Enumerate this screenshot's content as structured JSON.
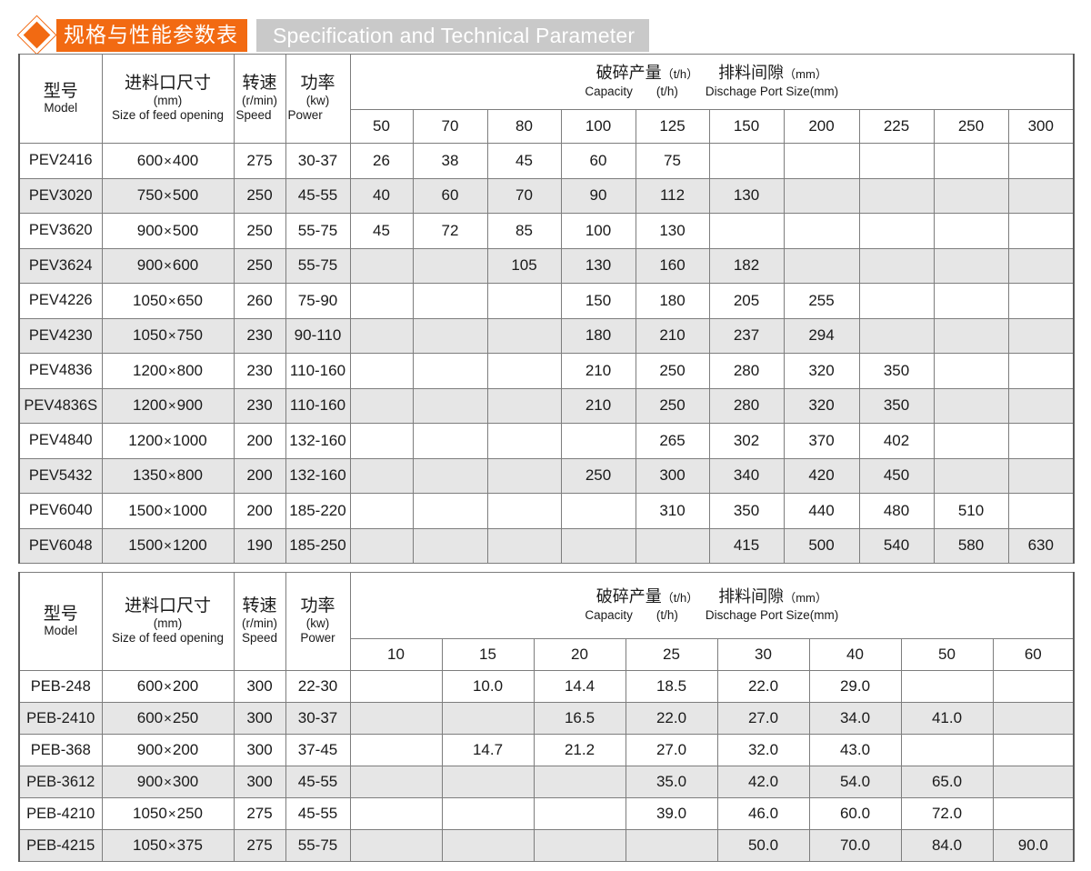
{
  "banner": {
    "diamond_icon": "diamond-icon",
    "title_cn": "规格与性能参数表",
    "title_en": "Specification and Technical Parameter"
  },
  "tables": [
    {
      "id": "pev-table",
      "headers": {
        "model_cn": "型号",
        "model_en": "Model",
        "feed_cn": "进料口尺寸",
        "feed_unit": "(mm)",
        "feed_en": "Size of feed opening",
        "speed_cn": "转速",
        "speed_unit": "(r/min)",
        "speed_en": "Speed",
        "power_cn": "功率",
        "power_unit": "(kw)",
        "power_en": "Power",
        "group_cn_1": "破碎产量",
        "group_cn_1_unit": "（t/h）",
        "group_cn_2": "排料间隙",
        "group_cn_2_unit": "（mm）",
        "group_en_1": "Capacity",
        "group_en_1_unit": "(t/h)",
        "group_en_2": "Dischage Port Size(mm)"
      },
      "gap_columns": [
        "50",
        "70",
        "80",
        "100",
        "125",
        "150",
        "200",
        "225",
        "250",
        "300"
      ],
      "rows": [
        {
          "model": "PEV2416",
          "feed_a": "600",
          "feed_b": "400",
          "speed": "275",
          "power": "30-37",
          "caps": [
            "26",
            "38",
            "45",
            "60",
            "75",
            "",
            "",
            "",
            "",
            ""
          ]
        },
        {
          "model": "PEV3020",
          "feed_a": "750",
          "feed_b": "500",
          "speed": "250",
          "power": "45-55",
          "caps": [
            "40",
            "60",
            "70",
            "90",
            "112",
            "130",
            "",
            "",
            "",
            ""
          ]
        },
        {
          "model": "PEV3620",
          "feed_a": "900",
          "feed_b": "500",
          "speed": "250",
          "power": "55-75",
          "caps": [
            "45",
            "72",
            "85",
            "100",
            "130",
            "",
            "",
            "",
            "",
            ""
          ]
        },
        {
          "model": "PEV3624",
          "feed_a": "900",
          "feed_b": "600",
          "speed": "250",
          "power": "55-75",
          "caps": [
            "",
            "",
            "105",
            "130",
            "160",
            "182",
            "",
            "",
            "",
            ""
          ]
        },
        {
          "model": "PEV4226",
          "feed_a": "1050",
          "feed_b": "650",
          "speed": "260",
          "power": "75-90",
          "caps": [
            "",
            "",
            "",
            "150",
            "180",
            "205",
            "255",
            "",
            "",
            ""
          ]
        },
        {
          "model": "PEV4230",
          "feed_a": "1050",
          "feed_b": "750",
          "speed": "230",
          "power": "90-110",
          "caps": [
            "",
            "",
            "",
            "180",
            "210",
            "237",
            "294",
            "",
            "",
            ""
          ]
        },
        {
          "model": "PEV4836",
          "feed_a": "1200",
          "feed_b": "800",
          "speed": "230",
          "power": "110-160",
          "caps": [
            "",
            "",
            "",
            "210",
            "250",
            "280",
            "320",
            "350",
            "",
            ""
          ]
        },
        {
          "model": "PEV4836S",
          "feed_a": "1200",
          "feed_b": "900",
          "speed": "230",
          "power": "110-160",
          "caps": [
            "",
            "",
            "",
            "210",
            "250",
            "280",
            "320",
            "350",
            "",
            ""
          ]
        },
        {
          "model": "PEV4840",
          "feed_a": "1200",
          "feed_b": "1000",
          "speed": "200",
          "power": "132-160",
          "caps": [
            "",
            "",
            "",
            "",
            "265",
            "302",
            "370",
            "402",
            "",
            ""
          ]
        },
        {
          "model": "PEV5432",
          "feed_a": "1350",
          "feed_b": "800",
          "speed": "200",
          "power": "132-160",
          "caps": [
            "",
            "",
            "",
            "250",
            "300",
            "340",
            "420",
            "450",
            "",
            ""
          ]
        },
        {
          "model": "PEV6040",
          "feed_a": "1500",
          "feed_b": "1000",
          "speed": "200",
          "power": "185-220",
          "caps": [
            "",
            "",
            "",
            "",
            "310",
            "350",
            "440",
            "480",
            "510",
            ""
          ]
        },
        {
          "model": "PEV6048",
          "feed_a": "1500",
          "feed_b": "1200",
          "speed": "190",
          "power": "185-250",
          "caps": [
            "",
            "",
            "",
            "",
            "",
            "415",
            "500",
            "540",
            "580",
            "630"
          ]
        }
      ]
    },
    {
      "id": "peb-table",
      "headers": {
        "model_cn": "型号",
        "model_en": "Model",
        "feed_cn": "进料口尺寸",
        "feed_unit": "(mm)",
        "feed_en": "Size of feed opening",
        "speed_cn": "转速",
        "speed_unit": "(r/min)",
        "speed_en": "Speed",
        "power_cn": "功率",
        "power_unit": "(kw)",
        "power_en": "Power",
        "group_cn_1": "破碎产量",
        "group_cn_1_unit": "（t/h）",
        "group_cn_2": "排料间隙",
        "group_cn_2_unit": "（mm）",
        "group_en_1": "Capacity",
        "group_en_1_unit": "(t/h)",
        "group_en_2": "Dischage Port Size(mm)"
      },
      "gap_columns": [
        "10",
        "15",
        "20",
        "25",
        "30",
        "40",
        "50",
        "60"
      ],
      "rows": [
        {
          "model": "PEB-248",
          "feed_a": "600",
          "feed_b": "200",
          "speed": "300",
          "power": "22-30",
          "caps": [
            "",
            "10.0",
            "14.4",
            "18.5",
            "22.0",
            "29.0",
            "",
            ""
          ]
        },
        {
          "model": "PEB-2410",
          "feed_a": "600",
          "feed_b": "250",
          "speed": "300",
          "power": "30-37",
          "caps": [
            "",
            "",
            "16.5",
            "22.0",
            "27.0",
            "34.0",
            "41.0",
            ""
          ]
        },
        {
          "model": "PEB-368",
          "feed_a": "900",
          "feed_b": "200",
          "speed": "300",
          "power": "37-45",
          "caps": [
            "",
            "14.7",
            "21.2",
            "27.0",
            "32.0",
            "43.0",
            "",
            ""
          ]
        },
        {
          "model": "PEB-3612",
          "feed_a": "900",
          "feed_b": "300",
          "speed": "300",
          "power": "45-55",
          "caps": [
            "",
            "",
            "",
            "35.0",
            "42.0",
            "54.0",
            "65.0",
            ""
          ]
        },
        {
          "model": "PEB-4210",
          "feed_a": "1050",
          "feed_b": "250",
          "speed": "275",
          "power": "45-55",
          "caps": [
            "",
            "",
            "",
            "39.0",
            "46.0",
            "60.0",
            "72.0",
            ""
          ]
        },
        {
          "model": "PEB-4215",
          "feed_a": "1050",
          "feed_b": "375",
          "speed": "275",
          "power": "55-75",
          "caps": [
            "",
            "",
            "",
            "",
            "50.0",
            "70.0",
            "84.0",
            "90.0"
          ]
        }
      ]
    }
  ],
  "colors": {
    "accent_orange": "#f26a12",
    "banner_gray": "#c9c9c9",
    "row_alt_gray": "#e6e6e6",
    "border_gray": "#7d7d7d"
  }
}
